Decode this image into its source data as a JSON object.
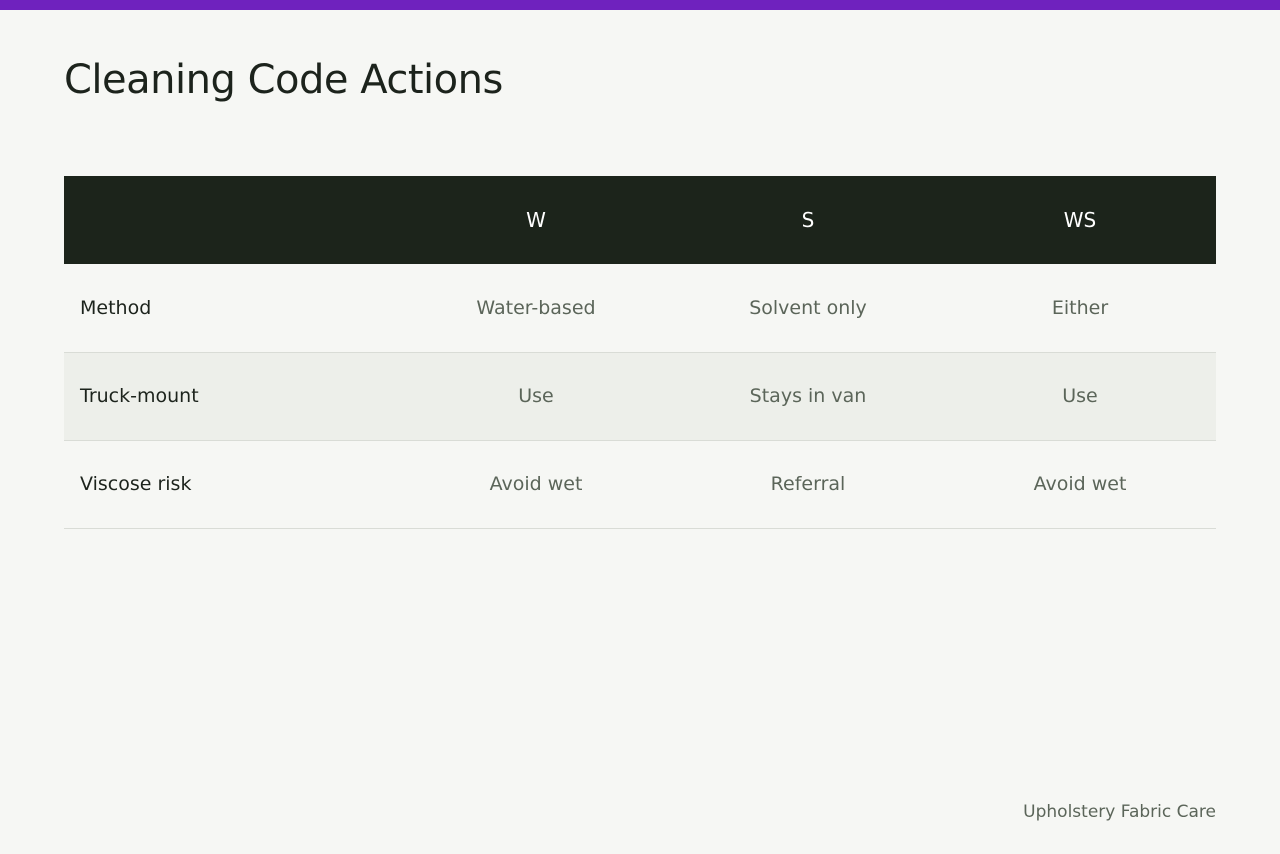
{
  "page": {
    "title": "Cleaning Code Actions",
    "footer": "Upholstery Fabric Care",
    "accent_color": "#6f22be",
    "header_color": "#1c241b"
  },
  "table": {
    "corner": "",
    "columns": [
      "W",
      "S",
      "WS"
    ],
    "rows": [
      {
        "label": "Method",
        "cells": [
          "Water-based",
          "Solvent only",
          "Either"
        ]
      },
      {
        "label": "Truck-mount",
        "cells": [
          "Use",
          "Stays in van",
          "Use"
        ]
      },
      {
        "label": "Viscose risk",
        "cells": [
          "Avoid wet",
          "Referral",
          "Avoid wet"
        ]
      }
    ]
  }
}
